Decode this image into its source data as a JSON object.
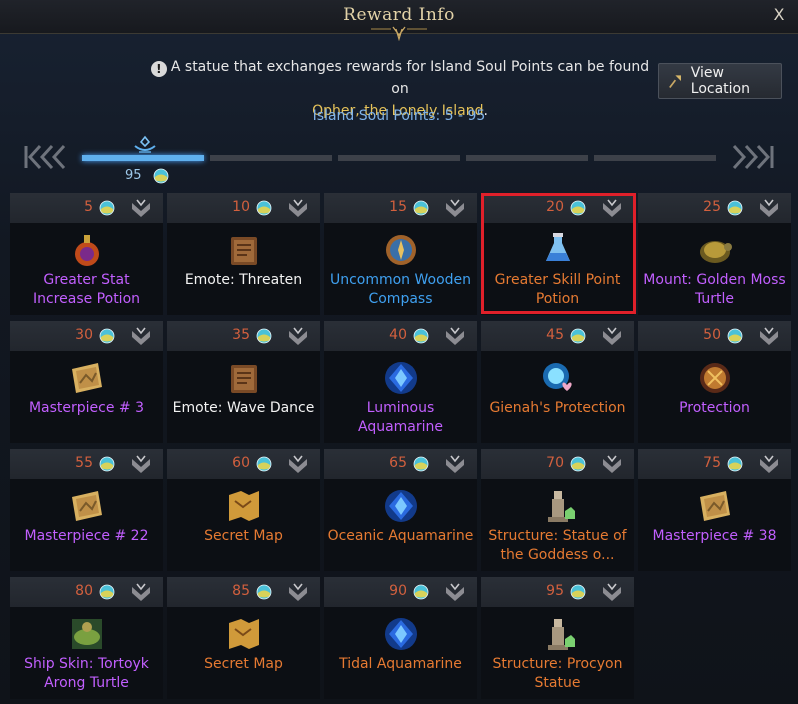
{
  "window": {
    "title": "Reward Info",
    "close_label": "X"
  },
  "notice": {
    "text": "A statue that exchanges rewards for Island Soul Points can be found on",
    "place": "Opher, the Lonely Island",
    "suffix": ".",
    "info_icon": "!"
  },
  "soul_points_range": "Island Soul Points: 5 - 95",
  "view_location_label": "View Location",
  "progress": {
    "current_value": "95",
    "current_fraction": 1.0,
    "segments_filled": 1,
    "segments_total": 5
  },
  "colors": {
    "purple": "#c25fff",
    "orange": "#e67a32",
    "blue": "#3fa0f0",
    "white": "#f2f2f2",
    "point_value": "#d2603e",
    "highlight": "#e0202a"
  },
  "rewards": [
    {
      "points": "5",
      "name": "Greater Stat Increase Potion",
      "rarity": "purple",
      "icon": "potion-flask-icon"
    },
    {
      "points": "10",
      "name": "Emote: Threaten",
      "rarity": "white",
      "icon": "book-icon"
    },
    {
      "points": "15",
      "name": "Uncommon Wooden Compass",
      "rarity": "blue",
      "icon": "compass-icon"
    },
    {
      "points": "20",
      "name": "Greater Skill Point Potion",
      "rarity": "orange",
      "icon": "potion-bottle-icon",
      "highlighted": true
    },
    {
      "points": "25",
      "name": "Mount: Golden Moss Turtle",
      "rarity": "purple",
      "icon": "turtle-icon"
    },
    {
      "points": "30",
      "name": "Masterpiece # 3",
      "rarity": "purple",
      "icon": "painting-icon"
    },
    {
      "points": "35",
      "name": "Emote: Wave Dance",
      "rarity": "white",
      "icon": "book-icon"
    },
    {
      "points": "40",
      "name": "Luminous Aquamarine",
      "rarity": "purple",
      "icon": "aquamarine-icon"
    },
    {
      "points": "45",
      "name": "Gienah's Protection",
      "rarity": "orange",
      "icon": "orb-heart-icon"
    },
    {
      "points": "50",
      "name": "Protection",
      "rarity": "purple",
      "icon": "rune-stone-icon"
    },
    {
      "points": "55",
      "name": "Masterpiece # 22",
      "rarity": "purple",
      "icon": "painting-icon"
    },
    {
      "points": "60",
      "name": "Secret Map",
      "rarity": "orange",
      "icon": "map-icon"
    },
    {
      "points": "65",
      "name": "Oceanic Aquamarine",
      "rarity": "orange",
      "icon": "aquamarine-icon"
    },
    {
      "points": "70",
      "name": "Structure: Statue of the Goddess o...",
      "rarity": "orange",
      "icon": "statue-icon"
    },
    {
      "points": "75",
      "name": "Masterpiece # 38",
      "rarity": "purple",
      "icon": "painting-icon"
    },
    {
      "points": "80",
      "name": "Ship Skin: Tortoyk Arong Turtle",
      "rarity": "purple",
      "icon": "ship-skin-icon"
    },
    {
      "points": "85",
      "name": "Secret Map",
      "rarity": "orange",
      "icon": "map-icon"
    },
    {
      "points": "90",
      "name": "Tidal Aquamarine",
      "rarity": "orange",
      "icon": "aquamarine-icon"
    },
    {
      "points": "95",
      "name": "Structure: Procyon Statue",
      "rarity": "orange",
      "icon": "statue-icon"
    }
  ]
}
